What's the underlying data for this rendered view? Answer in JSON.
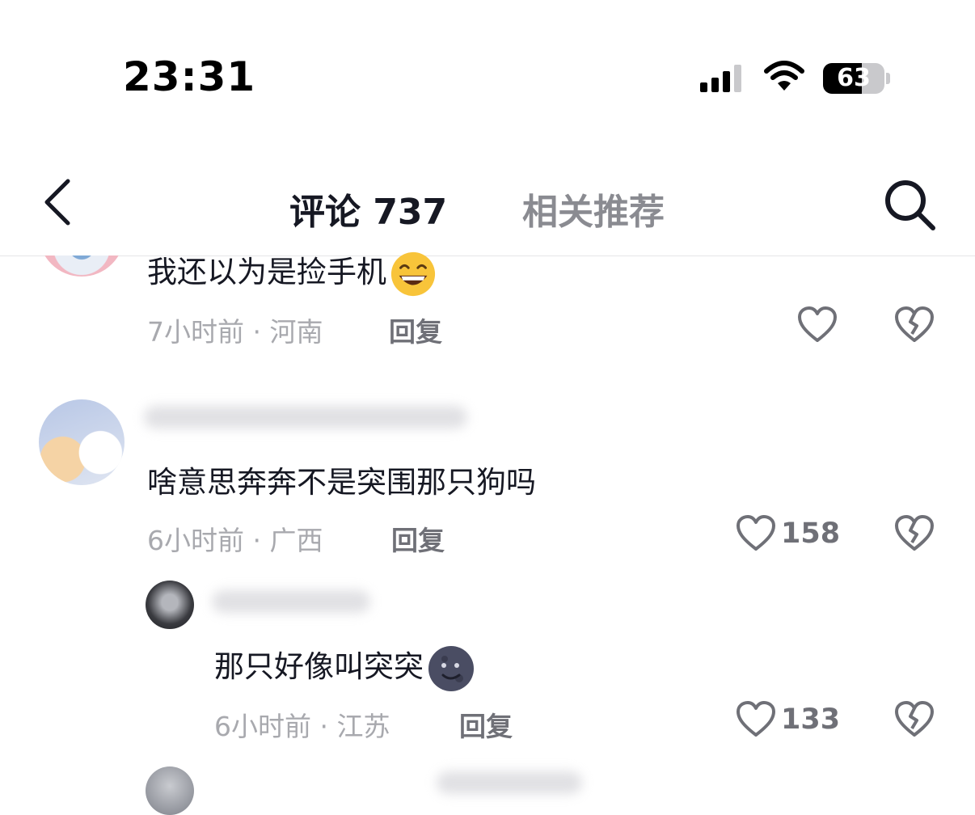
{
  "status_bar": {
    "time": "23:31",
    "battery": "63",
    "battery_level": 0.63
  },
  "header": {
    "tab_comments": "评论 737",
    "tab_related": "相关推荐"
  },
  "comments": [
    {
      "text": "我还以为是捡手机",
      "emoji": "grinning-face-icon",
      "time_location": "7小时前 · 河南",
      "reply_label": "回复",
      "like_count": ""
    },
    {
      "text": "啥意思奔奔不是突围那只狗吗",
      "time_location": "6小时前 · 广西",
      "reply_label": "回复",
      "like_count": "158"
    },
    {
      "text": "那只好像叫突突",
      "emoji": "new-moon-face-icon",
      "time_location": "6小时前 · 江苏",
      "reply_label": "回复",
      "like_count": "133"
    }
  ],
  "colors": {
    "text": "#161823",
    "muted": "#a8a9ae",
    "icon": "#6f7077"
  }
}
